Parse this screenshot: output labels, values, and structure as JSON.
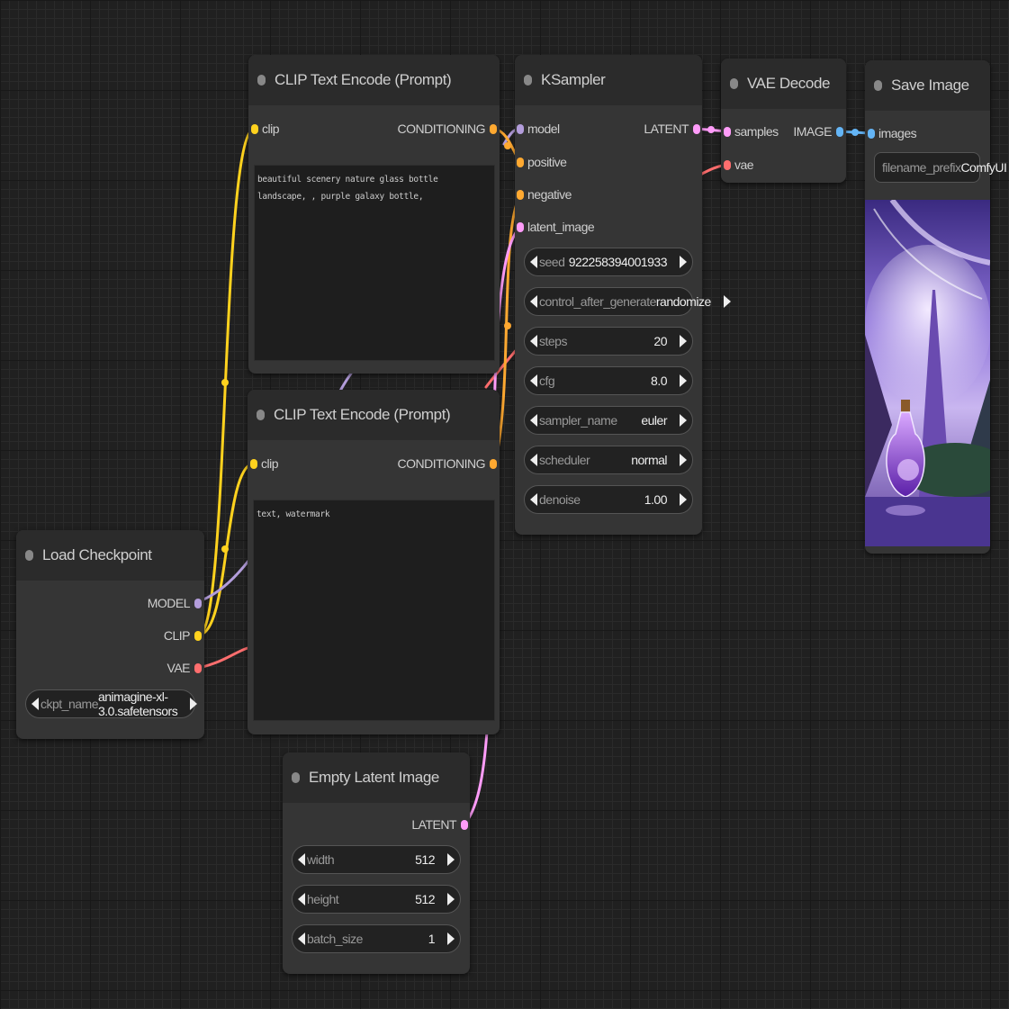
{
  "colors": {
    "canvas": "#202020",
    "node_body": "#353535",
    "node_title": "#2b2b2b",
    "clip": "#ffd21e",
    "conditioning": "#ffa931",
    "model": "#b39ddb",
    "latent": "#ff9cf9",
    "vae": "#ff6e6e",
    "image": "#64b5f6"
  },
  "nodes": {
    "clip_pos": {
      "title": "CLIP Text Encode (Prompt)",
      "input_clip": "clip",
      "output_conditioning": "CONDITIONING",
      "text": "beautiful scenery nature glass bottle landscape, , purple galaxy bottle,"
    },
    "clip_neg": {
      "title": "CLIP Text Encode (Prompt)",
      "input_clip": "clip",
      "output_conditioning": "CONDITIONING",
      "text": "text, watermark"
    },
    "ksampler": {
      "title": "KSampler",
      "inputs": [
        "model",
        "positive",
        "negative",
        "latent_image"
      ],
      "output": "LATENT",
      "widgets": [
        {
          "label": "seed",
          "value": "922258394001933"
        },
        {
          "label": "control_after_generate",
          "value": "randomize"
        },
        {
          "label": "steps",
          "value": "20"
        },
        {
          "label": "cfg",
          "value": "8.0"
        },
        {
          "label": "sampler_name",
          "value": "euler"
        },
        {
          "label": "scheduler",
          "value": "normal"
        },
        {
          "label": "denoise",
          "value": "1.00"
        }
      ]
    },
    "vae_decode": {
      "title": "VAE Decode",
      "input_samples": "samples",
      "input_vae": "vae",
      "output": "IMAGE"
    },
    "save_image": {
      "title": "Save Image",
      "input_images": "images",
      "filename_prefix_label": "filename_prefix",
      "filename_prefix_value": "ComfyUI",
      "preview_icon": "purple-galaxy-bottle-image"
    },
    "load_checkpoint": {
      "title": "Load Checkpoint",
      "outputs": [
        "MODEL",
        "CLIP",
        "VAE"
      ],
      "ckpt_label": "ckpt_name",
      "ckpt_value": "animagine-xl-3.0.safetensors"
    },
    "empty_latent": {
      "title": "Empty Latent Image",
      "output": "LATENT",
      "widgets": [
        {
          "label": "width",
          "value": "512"
        },
        {
          "label": "height",
          "value": "512"
        },
        {
          "label": "batch_size",
          "value": "1"
        }
      ]
    }
  }
}
